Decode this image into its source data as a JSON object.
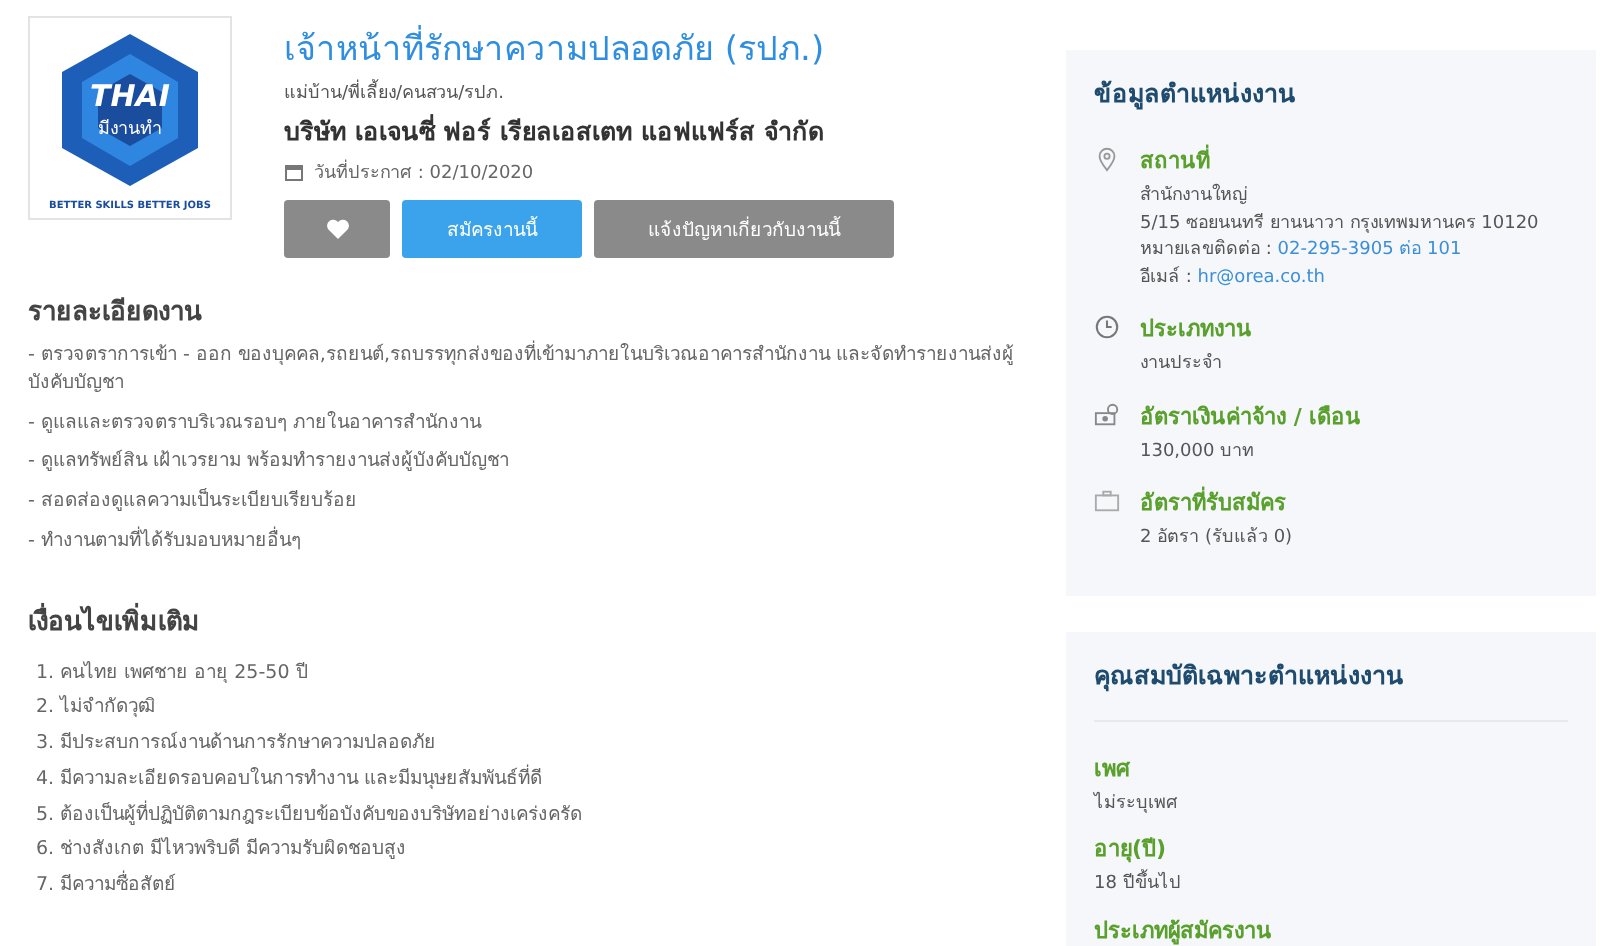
{
  "logo": {
    "brand": "THAI",
    "subtitle": "มีงานทำ",
    "tagline": "BETTER SKILLS BETTER JOBS"
  },
  "job": {
    "title": "เจ้าหน้าที่รักษาความปลอดภัย (รปภ.)",
    "category": "แม่บ้าน/พี่เลี้ยง/คนสวน/รปภ.",
    "company": "บริษัท เอเจนซี่ ฟอร์ เรียลเอสเตท แอฟแฟร์ส จำกัด",
    "posted_date": "วันที่ประกาศ : 02/10/2020"
  },
  "actions": [
    {
      "kind": "favorite"
    },
    {
      "kind": "primary",
      "label": "สมัครงานนี้"
    },
    {
      "kind": "secondary",
      "label": "แจ้งปัญหาเกี่ยวกับงานนี้"
    }
  ],
  "description": {
    "heading": "รายละเอียดงาน",
    "items": [
      "- ตรวจตราการเข้า - ออก ของบุคคล,รถยนต์,รถบรรทุกส่งของที่เข้ามาภายในบริเวณอาคารสำนักงาน และจัดทำรายงานส่งผู้บังคับบัญชา",
      "- ดูแลและตรวจตราบริเวณรอบๆ ภายในอาคารสำนักงาน",
      "- ดูแลทรัพย์สิน เฝ้าเวรยาม พร้อมทำรายงานส่งผู้บังคับบัญชา",
      "- สอดส่องดูแลความเป็นระเบียบเรียบร้อย",
      "- ทำงานตามที่ได้รับมอบหมายอื่นๆ"
    ]
  },
  "conditions": {
    "heading": "เงื่อนไขเพิ่มเติม",
    "items": [
      "1. คนไทย เพศชาย อายุ 25-50 ปี",
      "2. ไม่จำกัดวุฒิ",
      "3. มีประสบการณ์งานด้านการรักษาความปลอดภัย",
      "4. มีความละเอียดรอบคอบในการทำงาน และมีมนุษยสัมพันธ์ที่ดี",
      "5. ต้องเป็นผู้ที่ปฏิบัติตามกฎระเบียบข้อบังคับของบริษัทอย่างเคร่งครัด",
      "6. ช่างสังเกต มีไหวพริบดี มีความรับผิดชอบสูง",
      "7. มีความซื่อสัตย์"
    ]
  },
  "job_info": {
    "heading": "ข้อมูลตำแหน่งงาน",
    "fields": [
      {
        "kind": "location",
        "label": "สถานที่",
        "lines": [
          {
            "text": "สำนักงานใหญ่"
          },
          {
            "text": "5/15 ซอยนนทรี ยานนาวา กรุงเทพมหานคร 10120"
          },
          {
            "text": "หมายเลขติดต่อ :",
            "link": "02-295-3905 ต่อ 101"
          },
          {
            "text": "อีเมล์ :",
            "link": "hr@orea.co.th"
          }
        ]
      },
      {
        "kind": "type",
        "label": "ประเภทงาน",
        "lines": [
          {
            "text": "งานประจำ"
          }
        ]
      },
      {
        "kind": "salary",
        "label": "อัตราเงินค่าจ้าง / เดือน",
        "lines": [
          {
            "text": "130,000 บาท"
          }
        ]
      },
      {
        "kind": "openings",
        "label": "อัตราที่รับสมัคร",
        "lines": [
          {
            "text": "2 อัตรา (รับแล้ว 0)"
          }
        ]
      }
    ]
  },
  "qualifications": {
    "heading": "คุณสมบัติเฉพาะตำแหน่งงาน",
    "fields": [
      {
        "label": "เพศ",
        "value": "ไม่ระบุเพศ"
      },
      {
        "label": "อายุ(ปี)",
        "value": "18 ปีขึ้นไป"
      },
      {
        "label": "ประเภทผู้สมัครงาน"
      }
    ]
  }
}
